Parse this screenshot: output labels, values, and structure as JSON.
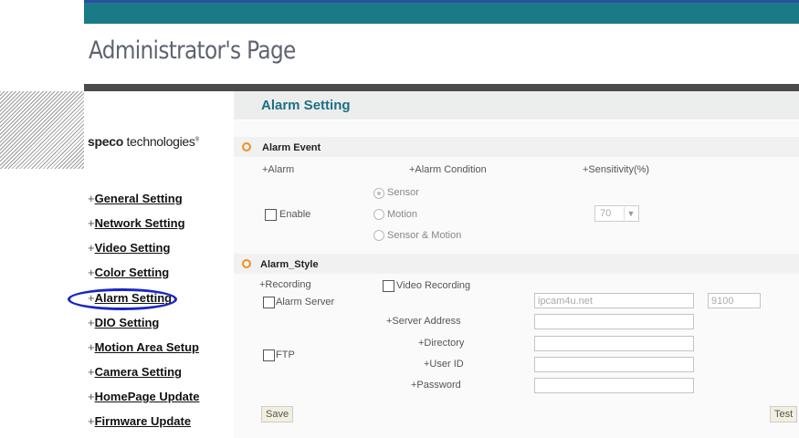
{
  "header": {
    "title": "Administrator's Page"
  },
  "logo": {
    "bold": "speco",
    "rest": " technologies",
    "mark": "®"
  },
  "sidebar": {
    "items": [
      {
        "plus": "+",
        "label": "General Setting"
      },
      {
        "plus": "+",
        "label": "Network Setting"
      },
      {
        "plus": "+",
        "label": "Video Setting"
      },
      {
        "plus": "+",
        "label": "Color Setting"
      },
      {
        "plus": "+",
        "label": "Alarm Setting"
      },
      {
        "plus": "+",
        "label": "DIO Setting"
      },
      {
        "plus": "+",
        "label": "Motion Area Setup"
      },
      {
        "plus": "+",
        "label": "Camera Setting"
      },
      {
        "plus": "+",
        "label": "HomePage Update"
      },
      {
        "plus": "+",
        "label": "Firmware Update"
      }
    ]
  },
  "main": {
    "page_title": "Alarm Setting",
    "alarm_event": {
      "title": "Alarm Event",
      "col_alarm": "+Alarm",
      "col_condition": "+Alarm Condition",
      "col_sensitivity": "+Sensitivity(%)",
      "enable_label": "Enable",
      "conditions": [
        "Sensor",
        "Motion",
        "Sensor & Motion"
      ],
      "selected_condition": "Sensor",
      "sensitivity_value": "70"
    },
    "alarm_style": {
      "title": "Alarm_Style",
      "recording_label": "+Recording",
      "video_recording_label": "Video Recording",
      "alarm_server_label": "Alarm Server",
      "alarm_server_host": "ipcam4u.net",
      "alarm_server_port": "9100",
      "ftp_label": "FTP",
      "server_address_label": "+Server Address",
      "directory_label": "+Directory",
      "user_id_label": "+User ID",
      "password_label": "+Password"
    },
    "buttons": {
      "save": "Save",
      "test": "Test"
    }
  }
}
